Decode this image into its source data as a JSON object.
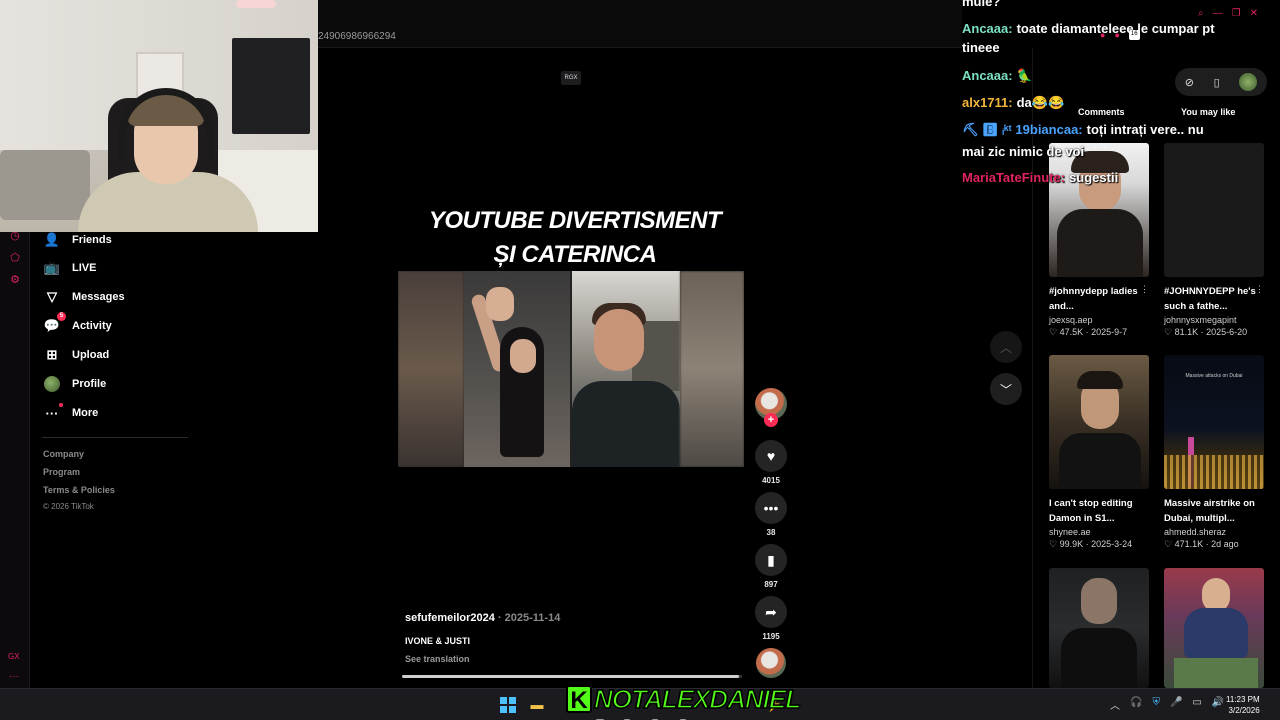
{
  "browser": {
    "url_fragment": "24906986966294",
    "badge_count": "16"
  },
  "sidebar": {
    "items": [
      {
        "label": "Friends",
        "icon": "friends-icon"
      },
      {
        "label": "LIVE",
        "icon": "live-tv-icon"
      },
      {
        "label": "Messages",
        "icon": "messages-icon"
      },
      {
        "label": "Activity",
        "icon": "activity-icon",
        "badge": "5"
      },
      {
        "label": "Upload",
        "icon": "upload-icon"
      },
      {
        "label": "Profile",
        "icon": "profile-avatar"
      },
      {
        "label": "More",
        "icon": "more-icon"
      }
    ],
    "footer": [
      "Company",
      "Program",
      "Terms & Policies"
    ],
    "copyright": "© 2026 TikTok"
  },
  "video": {
    "rgx_label": "RGX",
    "title_line1": "YOUTUBE DIVERTISMENT",
    "title_line2": "ȘI CATERINCA",
    "author": "sefufemeilor2024",
    "date": " · 2025-11-14",
    "caption": "IVONE & JUSTI",
    "see_translation": "See translation",
    "progress": 0.99,
    "likes": "4015",
    "comments": "38",
    "saves": "897",
    "shares": "1195"
  },
  "right_panel": {
    "tab_comments": "Comments",
    "tab_you_may_like": "You may like",
    "cards": [
      {
        "title": "#johnnydepp ladies and...",
        "user": "joexsq.aep",
        "stats": "♡ 47.5K · 2025-9-7"
      },
      {
        "title": "#JOHNNYDEPP he's such a fathe...",
        "user": "johnnysxmegapint",
        "stats": "♡ 81.1K · 2025-6-20"
      },
      {
        "title": "I can't stop editing Damon in S1...",
        "user": "shynee.ae",
        "stats": "♡ 99.9K · 2025-3-24"
      },
      {
        "title": "Massive airstrike on Dubai, multipl...",
        "user": "ahmedd.sheraz",
        "stats": "♡ 471.1K · 2d ago",
        "overlay": "Massive attacks on Dubai"
      }
    ]
  },
  "chat": [
    {
      "user": "",
      "text": "mule?",
      "color": "#ffffff"
    },
    {
      "user": "Ancaaa:",
      "text": "toate diamanteleee le cumpar pt",
      "color": "#7be0c4"
    },
    {
      "user": "",
      "text": "tineee",
      "color": "#ffffff"
    },
    {
      "user": "Ancaaa:",
      "text": "🦜",
      "color": "#7be0c4"
    },
    {
      "user": "alx1711:",
      "text": "da😂😂",
      "color": "#f2b63a"
    },
    {
      "user": "19biancaa:",
      "text": "toți intrați vere.. nu",
      "color": "#4aa3ff"
    },
    {
      "user": "",
      "text": "mai zic nimic de voi",
      "color": "#ffffff"
    },
    {
      "user": "MariaTateFinute:",
      "text": "sugestii",
      "color": "#e0245e"
    }
  ],
  "taskbar": {
    "streamer": "NOTALEXDANIEL",
    "kick_letter": "K",
    "time": "11:23 PM",
    "date": "3/2/2026"
  },
  "colors": {
    "accent_pink": "#fe2c55",
    "gx_red": "#e0245e",
    "kick_green": "#53fc18"
  }
}
